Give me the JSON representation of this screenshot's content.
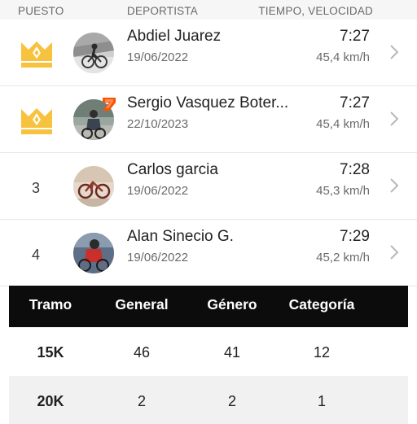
{
  "header": {
    "rank": "PUESTO",
    "athlete": "DEPORTISTA",
    "time_speed": "TIEMPO, VELOCIDAD"
  },
  "leaderboard": [
    {
      "rank": "",
      "crown": true,
      "name": "Abdiel Juarez",
      "date": "19/06/2022",
      "time": "7:27",
      "speed": "45,4 km/h"
    },
    {
      "rank": "",
      "crown": true,
      "name": "Sergio Vasquez Boter...",
      "date": "22/10/2023",
      "time": "7:27",
      "speed": "45,4 km/h"
    },
    {
      "rank": "3",
      "crown": false,
      "name": "Carlos garcia",
      "date": "19/06/2022",
      "time": "7:28",
      "speed": "45,3 km/h"
    },
    {
      "rank": "4",
      "crown": false,
      "name": "Alan Sinecio G.",
      "date": "19/06/2022",
      "time": "7:29",
      "speed": "45,2 km/h"
    }
  ],
  "segments": {
    "headers": [
      "Tramo",
      "General",
      "Género",
      "Categoría"
    ],
    "rows": [
      [
        "15K",
        "46",
        "41",
        "12"
      ],
      [
        "20K",
        "2",
        "2",
        "1"
      ]
    ]
  },
  "colors": {
    "crown": "#f7c23d",
    "badge": "#fc5200",
    "table_header": "#0c0c0c"
  },
  "icons": {
    "crown": "crown-icon",
    "chevron": "chevron-right-icon",
    "badge": "subscriber-badge-icon"
  }
}
